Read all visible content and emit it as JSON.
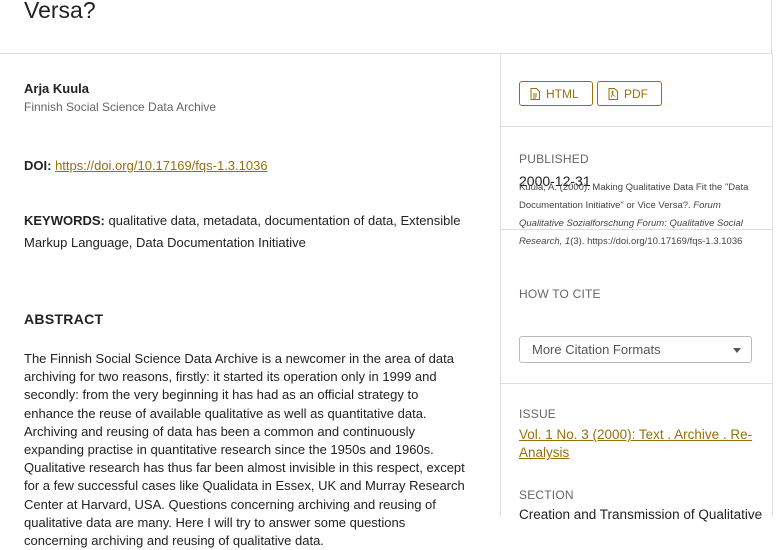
{
  "article": {
    "title_fragment": "Versa?",
    "author": {
      "name": "Arja Kuula",
      "affiliation": "Finnish Social Science Data Archive"
    },
    "doi": {
      "label": "DOI:",
      "url": "https://doi.org/10.17169/fqs-1.3.1036"
    },
    "keywords": {
      "label": "KEYWORDS:",
      "value": "qualitative data, metadata, documentation of data, Extensible Markup Language, Data Documentation Initiative"
    },
    "abstract": {
      "heading": "ABSTRACT",
      "text": "The Finnish Social Science Data Archive is a newcomer in the area of data archiving for two reasons, firstly: it started its operation only in 1999 and secondly: from the very beginning it has had as an official strategy to enhance the reuse of available qualitative as well as quantitative data. Archiving and reusing of data has been a common and continuously expanding practise in quantitative research since the 1950s and 1960s. Qualitative research has thus far been almost invisible in this respect, except for a few successful cases like Qualidata in Essex, UK and Murray Research Center at Harvard, USA. Questions concerning archiving and reusing of qualitative data are many. Here I will try to answer some questions concerning archiving and reusing of qualitative data."
    }
  },
  "sidebar": {
    "galleys": [
      {
        "label": "HTML",
        "icon": "file-text-icon"
      },
      {
        "label": "PDF",
        "icon": "file-pdf-icon"
      }
    ],
    "published": {
      "label": "PUBLISHED",
      "value": "2000-12-31"
    },
    "how_to_cite": {
      "label": "HOW TO CITE",
      "citation_plain": "Kuula, A. (2000). Making Qualitative Data Fit the \"Data Documentation Initiative\" or Vice Versa?.",
      "citation_journal": "Forum Qualitative Sozialforschung Forum: Qualitative Social Research, 1",
      "citation_rest": "(3). https://doi.org/10.17169/fqs-1.3.1036",
      "formats_label": "More Citation Formats"
    },
    "issue": {
      "label": "ISSUE",
      "value": "Vol. 1 No. 3 (2000): Text . Archive . Re-Analysis"
    },
    "section": {
      "label": "SECTION",
      "value": "Creation and Transmission of Qualitative"
    }
  },
  "colors": {
    "accent": "#98700a",
    "border": "#dddddd",
    "muted": "#666666"
  }
}
